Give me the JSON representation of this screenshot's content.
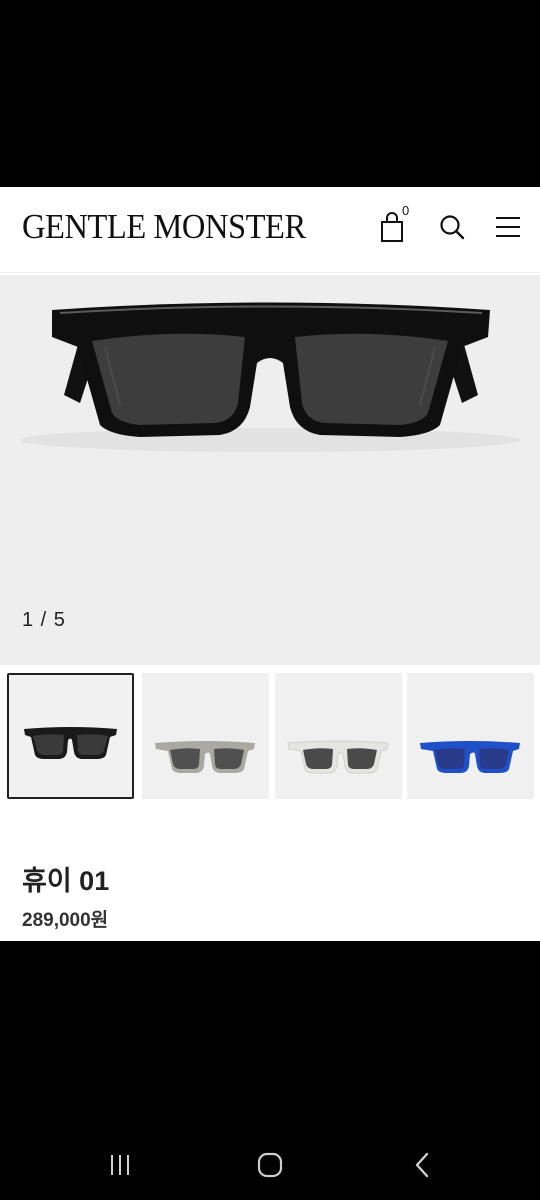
{
  "header": {
    "logo": "GENTLE MONSTER",
    "cart_count": "0",
    "icons": [
      "shopping-bag-icon",
      "search-icon",
      "hamburger-menu-icon"
    ]
  },
  "gallery": {
    "counter": "1 / 5",
    "thumbnails": [
      {
        "variant": "black",
        "frame_color": "#1a1a1a",
        "lens_color": "#3a3a3a",
        "selected": true
      },
      {
        "variant": "grey",
        "frame_color": "#a9a9a2",
        "lens_color": "#505050",
        "selected": false
      },
      {
        "variant": "clear",
        "frame_color": "#e4e4e0",
        "lens_color": "#4a4a4a",
        "selected": false
      },
      {
        "variant": "blue",
        "frame_color": "#1f50c8",
        "lens_color": "#2a3a8a",
        "selected": false
      }
    ]
  },
  "product": {
    "name": "휴이 01",
    "price": "289,000원"
  },
  "system_nav": {
    "icons": [
      "recent-apps-icon",
      "home-icon",
      "back-icon"
    ]
  }
}
